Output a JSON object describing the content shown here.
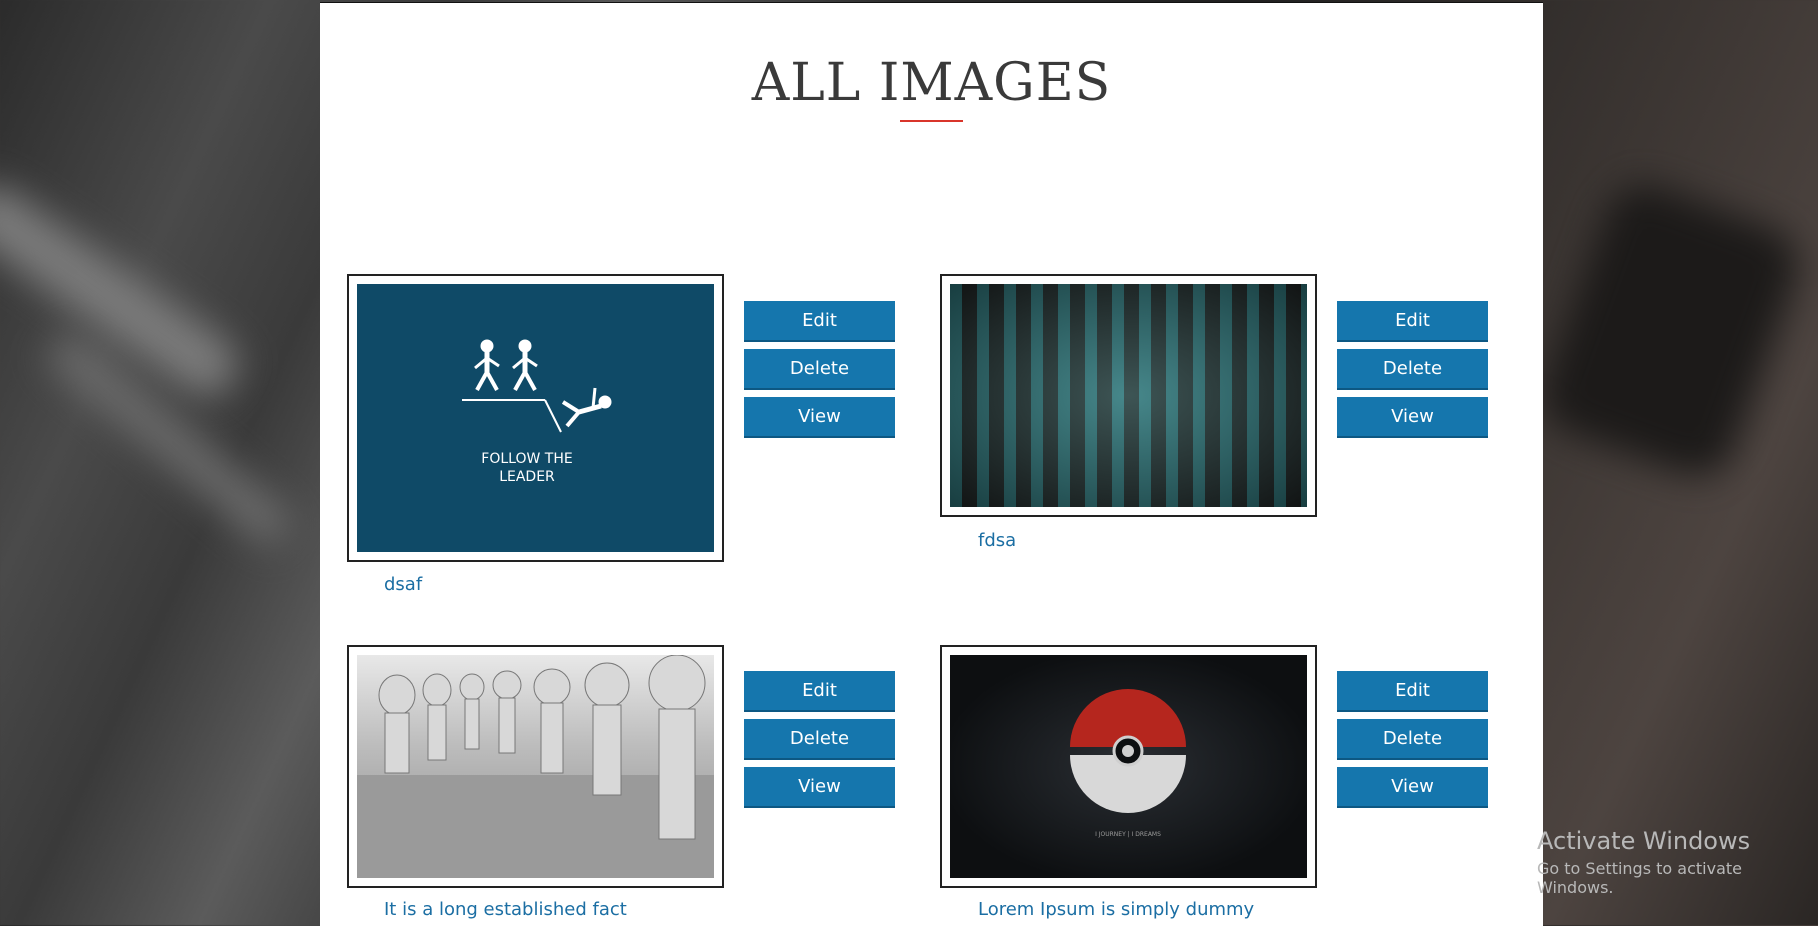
{
  "page": {
    "title": "ALL IMAGES"
  },
  "buttons": {
    "edit": "Edit",
    "delete": "Delete",
    "view": "View"
  },
  "images": [
    {
      "caption": "dsaf",
      "art_text_1": "FOLLOW THE",
      "art_text_2": "LEADER"
    },
    {
      "caption": "fdsa"
    },
    {
      "caption": "It is a long established fact"
    },
    {
      "caption": "Lorem Ipsum is simply dummy",
      "art_text": "I JOURNEY | I DREAMS"
    }
  ],
  "watermark": {
    "line1": "Activate Windows",
    "line2": "Go to Settings to activate Windows."
  },
  "colors": {
    "accent": "#d9352b",
    "button": "#1576ad",
    "caption": "#1b6ea3"
  }
}
